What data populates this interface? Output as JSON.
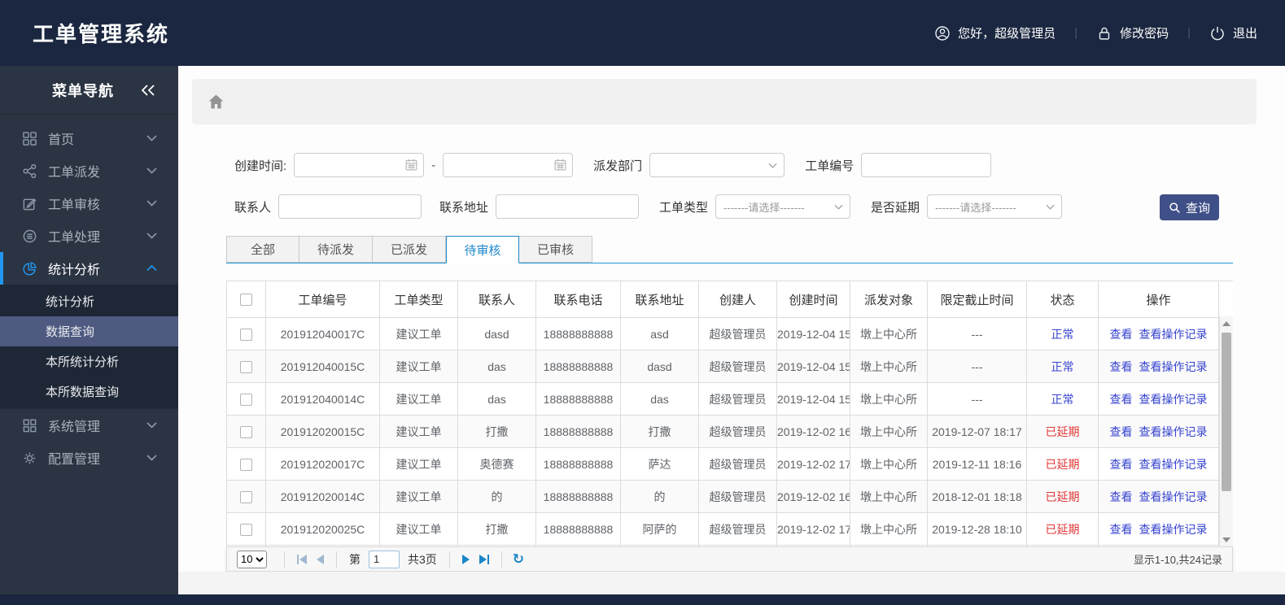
{
  "app": {
    "title": "工单管理系统"
  },
  "header": {
    "greeting": "您好，超级管理员",
    "change_password": "修改密码",
    "logout": "退出",
    "separator": "|"
  },
  "sidebar": {
    "title": "菜单导航",
    "items": [
      {
        "key": "home",
        "label": "首页",
        "icon": "grid-icon",
        "expanded": false,
        "active": false
      },
      {
        "key": "dispatch",
        "label": "工单派发",
        "icon": "share-icon",
        "expanded": false,
        "active": false
      },
      {
        "key": "review",
        "label": "工单审核",
        "icon": "edit-icon",
        "expanded": false,
        "active": false
      },
      {
        "key": "process",
        "label": "工单处理",
        "icon": "process-icon",
        "expanded": false,
        "active": false
      },
      {
        "key": "stats",
        "label": "统计分析",
        "icon": "pie-icon",
        "expanded": true,
        "active": true,
        "children": [
          {
            "label": "统计分析",
            "selected": false
          },
          {
            "label": "数据查询",
            "selected": true
          },
          {
            "label": "本所统计分析",
            "selected": false
          },
          {
            "label": "本所数据查询",
            "selected": false
          }
        ]
      },
      {
        "key": "system",
        "label": "系统管理",
        "icon": "apps-icon",
        "expanded": false,
        "active": false
      },
      {
        "key": "config",
        "label": "配置管理",
        "icon": "gear-icon",
        "expanded": false,
        "active": false
      }
    ]
  },
  "filters": {
    "created_time_label": "创建时间:",
    "date_from_value": "",
    "date_to_value": "",
    "range_separator": "-",
    "dispatch_dept_label": "派发部门",
    "dispatch_dept_value": "",
    "order_no_label": "工单编号",
    "order_no_value": "",
    "contact_label": "联系人",
    "contact_value": "",
    "address_label": "联系地址",
    "address_value": "",
    "order_type_label": "工单类型",
    "order_type_value": "-------请选择-------",
    "is_delayed_label": "是否延期",
    "is_delayed_value": "-------请选择-------",
    "search_button": "查询"
  },
  "tabs": [
    {
      "label": "全部",
      "active": false
    },
    {
      "label": "待派发",
      "active": false
    },
    {
      "label": "已派发",
      "active": false
    },
    {
      "label": "待审核",
      "active": true
    },
    {
      "label": "已审核",
      "active": false
    }
  ],
  "table": {
    "columns": [
      "工单编号",
      "工单类型",
      "联系人",
      "联系电话",
      "联系地址",
      "创建人",
      "创建时间",
      "派发对象",
      "限定截止时间",
      "状态",
      "操作"
    ],
    "action_labels": [
      "查看",
      "查看操作记录"
    ],
    "status_colors": {
      "正常": "#3643cf",
      "已延期": "#e23434"
    },
    "rows": [
      {
        "id": "201912040017C",
        "type": "建议工单",
        "contact": "dasd",
        "phone": "18888888888",
        "address": "asd",
        "creator": "超级管理员",
        "created": "2019-12-04 15",
        "target": "墩上中心所",
        "deadline": "---",
        "status": "正常"
      },
      {
        "id": "201912040015C",
        "type": "建议工单",
        "contact": "das",
        "phone": "18888888888",
        "address": "dasd",
        "creator": "超级管理员",
        "created": "2019-12-04 15",
        "target": "墩上中心所",
        "deadline": "---",
        "status": "正常"
      },
      {
        "id": "201912040014C",
        "type": "建议工单",
        "contact": "das",
        "phone": "18888888888",
        "address": "das",
        "creator": "超级管理员",
        "created": "2019-12-04 15",
        "target": "墩上中心所",
        "deadline": "---",
        "status": "正常"
      },
      {
        "id": "201912020015C",
        "type": "建议工单",
        "contact": "打撒",
        "phone": "18888888888",
        "address": "打撒",
        "creator": "超级管理员",
        "created": "2019-12-02 16",
        "target": "墩上中心所",
        "deadline": "2019-12-07 18:17",
        "status": "已延期"
      },
      {
        "id": "201912020017C",
        "type": "建议工单",
        "contact": "奥德赛",
        "phone": "18888888888",
        "address": "萨达",
        "creator": "超级管理员",
        "created": "2019-12-02 17",
        "target": "墩上中心所",
        "deadline": "2019-12-11 18:16",
        "status": "已延期"
      },
      {
        "id": "201912020014C",
        "type": "建议工单",
        "contact": "的",
        "phone": "18888888888",
        "address": "的",
        "creator": "超级管理员",
        "created": "2019-12-02 16",
        "target": "墩上中心所",
        "deadline": "2018-12-01 18:18",
        "status": "已延期"
      },
      {
        "id": "201912020025C",
        "type": "建议工单",
        "contact": "打撒",
        "phone": "18888888888",
        "address": "阿萨的",
        "creator": "超级管理员",
        "created": "2019-12-02 17",
        "target": "墩上中心所",
        "deadline": "2019-12-28 18:10",
        "status": "已延期"
      }
    ]
  },
  "pagination": {
    "page_size": "10",
    "page_prefix": "第",
    "page_value": "1",
    "total_pages": "共3页",
    "summary": "显示1-10,共24记录"
  },
  "colors": {
    "header_navy": "#1b2740",
    "sidebar_slate": "#2b3442",
    "sidebar_active_accent": "#2196f3",
    "submenu_selected": "#4e5a80",
    "tab_blue": "#1e88c9",
    "link_blue": "#3643cf",
    "status_red": "#e23434",
    "search_button_indigo": "#3f4f87"
  }
}
